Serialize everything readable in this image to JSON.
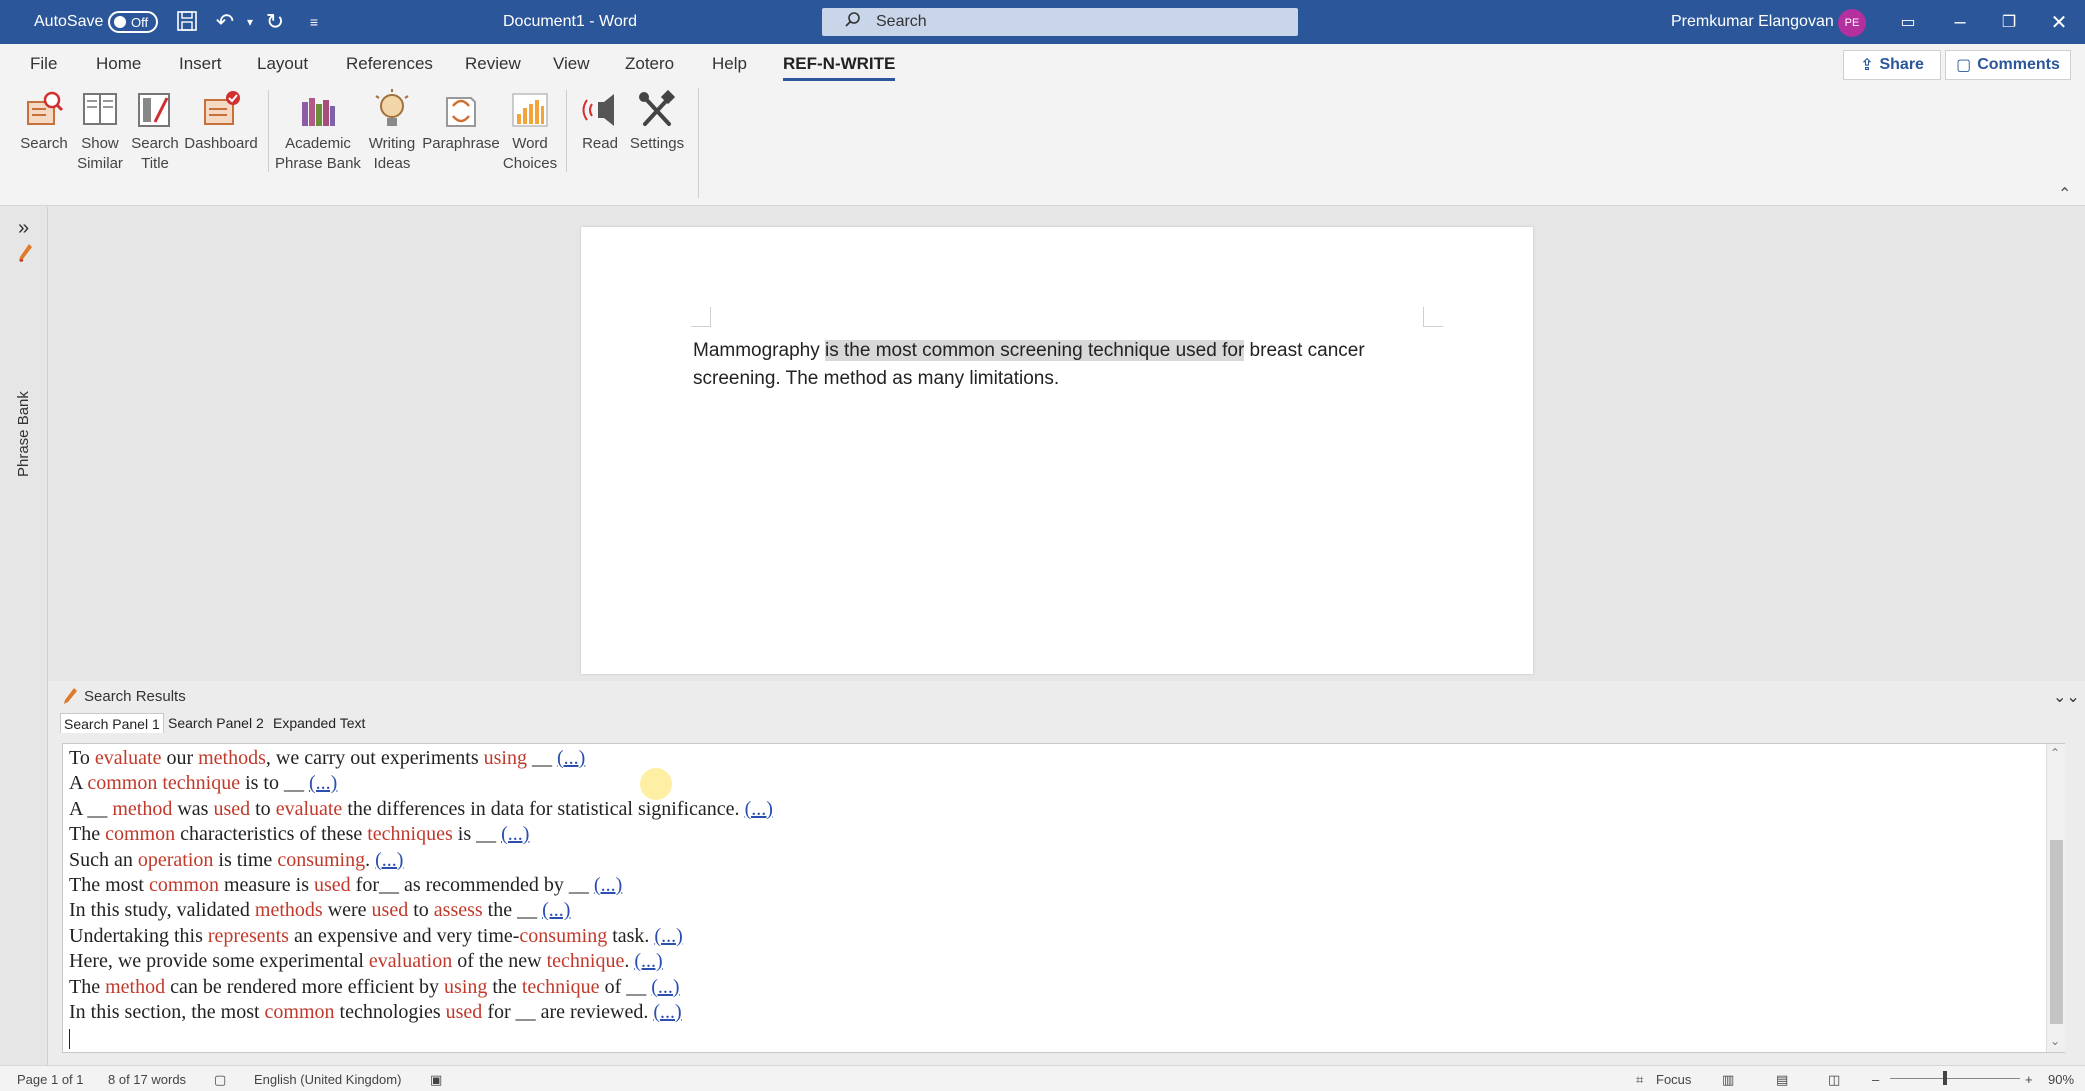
{
  "titlebar": {
    "autosave_label": "AutoSave",
    "autosave_state": "Off",
    "doc_title": "Document1  -  Word",
    "search_placeholder": "Search",
    "user_name": "Premkumar Elangovan",
    "user_initials": "PE"
  },
  "tabs": [
    "File",
    "Home",
    "Insert",
    "Layout",
    "References",
    "Review",
    "View",
    "Zotero",
    "Help",
    "REF-N-WRITE"
  ],
  "active_tab": "REF-N-WRITE",
  "share_label": "Share",
  "comments_label": "Comments",
  "ribbon": {
    "search": [
      "Search"
    ],
    "show_similar": [
      "Show",
      "Similar"
    ],
    "search_title": [
      "Search",
      "Title"
    ],
    "dashboard": [
      "Dashboard"
    ],
    "academic_phrase_bank": [
      "Academic",
      "Phrase Bank"
    ],
    "writing_ideas": [
      "Writing",
      "Ideas"
    ],
    "paraphrase": [
      "Paraphrase"
    ],
    "word_choices": [
      "Word",
      "Choices"
    ],
    "read": [
      "Read"
    ],
    "settings": [
      "Settings"
    ]
  },
  "side_pane_label": "Phrase Bank",
  "document": {
    "before": "Mammography ",
    "highlight": "is the most common screening technique used for",
    "after": " breast cancer screening. The method as many limitations."
  },
  "results": {
    "header": "Search Results",
    "subtabs": [
      "Search Panel 1",
      "Search Panel 2",
      "Expanded Text"
    ],
    "link_text": "(...)",
    "lines": [
      [
        [
          "To ",
          0
        ],
        [
          "evaluate",
          1
        ],
        [
          " our ",
          0
        ],
        [
          "methods",
          1
        ],
        [
          ", we carry out experiments ",
          0
        ],
        [
          "using",
          1
        ],
        [
          " __ ",
          0
        ]
      ],
      [
        [
          "A ",
          0
        ],
        [
          "common",
          1
        ],
        [
          " ",
          0
        ],
        [
          "technique",
          1
        ],
        [
          " is to  __  ",
          0
        ]
      ],
      [
        [
          "A __ ",
          0
        ],
        [
          "method",
          1
        ],
        [
          " was ",
          0
        ],
        [
          "used",
          1
        ],
        [
          " to ",
          0
        ],
        [
          "evaluate",
          1
        ],
        [
          " the differences in data for statistical significance. ",
          0
        ]
      ],
      [
        [
          "The ",
          0
        ],
        [
          "common",
          1
        ],
        [
          " characteristics of these ",
          0
        ],
        [
          "techniques",
          1
        ],
        [
          " is __ ",
          0
        ]
      ],
      [
        [
          "Such an ",
          0
        ],
        [
          "operation",
          1
        ],
        [
          " is time ",
          0
        ],
        [
          "consuming",
          1
        ],
        [
          ". ",
          0
        ]
      ],
      [
        [
          "The most ",
          0
        ],
        [
          "common",
          1
        ],
        [
          " measure is ",
          0
        ],
        [
          "used",
          1
        ],
        [
          " for__ as recommended by __ ",
          0
        ]
      ],
      [
        [
          "In this study, validated ",
          0
        ],
        [
          "methods",
          1
        ],
        [
          " were ",
          0
        ],
        [
          "used",
          1
        ],
        [
          " to ",
          0
        ],
        [
          "assess",
          1
        ],
        [
          " the __  ",
          0
        ]
      ],
      [
        [
          "Undertaking this ",
          0
        ],
        [
          "represents",
          1
        ],
        [
          " an expensive and very time-",
          0
        ],
        [
          "consuming",
          1
        ],
        [
          " task. ",
          0
        ]
      ],
      [
        [
          "Here, we provide some experimental ",
          0
        ],
        [
          "evaluation",
          1
        ],
        [
          " of the new ",
          0
        ],
        [
          "technique",
          1
        ],
        [
          ".  ",
          0
        ]
      ],
      [
        [
          "The ",
          0
        ],
        [
          "method",
          1
        ],
        [
          " can be rendered more efficient by ",
          0
        ],
        [
          "using",
          1
        ],
        [
          " the ",
          0
        ],
        [
          "technique",
          1
        ],
        [
          " of __  ",
          0
        ]
      ],
      [
        [
          "In this section, the most ",
          0
        ],
        [
          "common",
          1
        ],
        [
          " technologies ",
          0
        ],
        [
          "used",
          1
        ],
        [
          " for __ are reviewed. ",
          0
        ]
      ]
    ]
  },
  "status": {
    "page": "Page 1 of 1",
    "words": "8 of 17 words",
    "language": "English (United Kingdom)",
    "focus": "Focus",
    "zoom": "90%"
  },
  "colors": {
    "titlebar": "#2b579a",
    "keyword": "#c0392b",
    "link": "#2a4fb0",
    "highlight": "#d8d8d8"
  }
}
